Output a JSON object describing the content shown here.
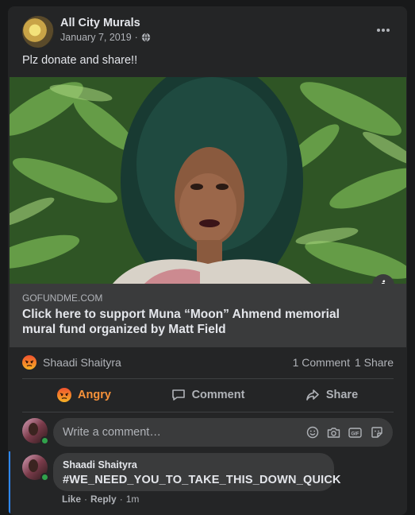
{
  "post": {
    "author": "All City Murals",
    "date": "January 7, 2019",
    "separator": "·",
    "text": "Plz donate and share!!"
  },
  "link": {
    "domain": "GOFUNDME.COM",
    "title": "Click here to support Muna “Moon” Ahmend memorial mural fund organized by Matt Field"
  },
  "stats": {
    "reactor": "Shaadi Shaityra",
    "comments": "1 Comment",
    "shares": "1 Share"
  },
  "actions": {
    "angry": "Angry",
    "comment": "Comment",
    "share": "Share"
  },
  "composer": {
    "placeholder": "Write a comment…"
  },
  "comment": {
    "author": "Shaadi Shaityra",
    "text": "#WE_NEED_YOU_TO_TAKE_THIS_DOWN_QUICK",
    "like": "Like",
    "reply": "Reply",
    "dot": "·",
    "time": "1m"
  },
  "colors": {
    "background": "#18191a",
    "card": "#242526",
    "angry": "#f7923a",
    "online": "#31a24c",
    "thread": "#2d88ff"
  },
  "icons": [
    "globe-icon",
    "more-icon",
    "info-icon",
    "angry-reaction-icon",
    "comment-icon",
    "share-icon",
    "emoji-icon",
    "camera-icon",
    "gif-icon",
    "sticker-icon"
  ]
}
